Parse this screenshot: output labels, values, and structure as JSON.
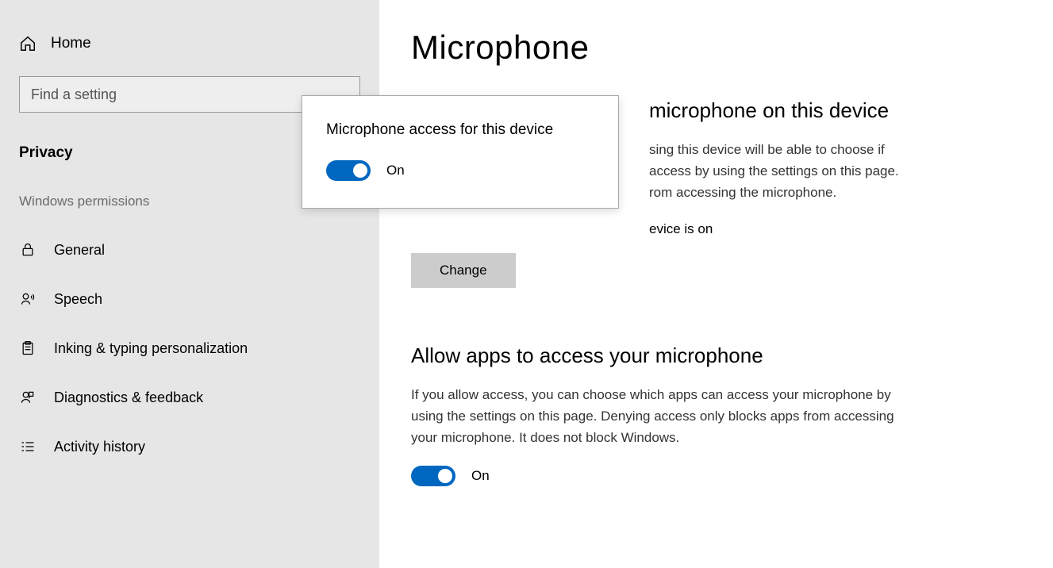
{
  "sidebar": {
    "home": "Home",
    "search_placeholder": "Find a setting",
    "section": "Privacy",
    "group": "Windows permissions",
    "items": [
      {
        "label": "General"
      },
      {
        "label": "Speech"
      },
      {
        "label": "Inking & typing personalization"
      },
      {
        "label": "Diagnostics & feedback"
      },
      {
        "label": "Activity history"
      }
    ]
  },
  "main": {
    "title": "Microphone",
    "section1": {
      "heading_suffix": "microphone on this device",
      "body_suffix": "sing this device will be able to choose if access by using the settings on this page. rom accessing the microphone.",
      "status_suffix": "evice is on",
      "change_btn": "Change"
    },
    "section2": {
      "heading": "Allow apps to access your microphone",
      "body": "If you allow access, you can choose which apps can access your microphone by using the settings on this page. Denying access only blocks apps from accessing your microphone. It does not block Windows.",
      "toggle_label": "On"
    }
  },
  "popup": {
    "title": "Microphone access for this device",
    "toggle_label": "On"
  }
}
